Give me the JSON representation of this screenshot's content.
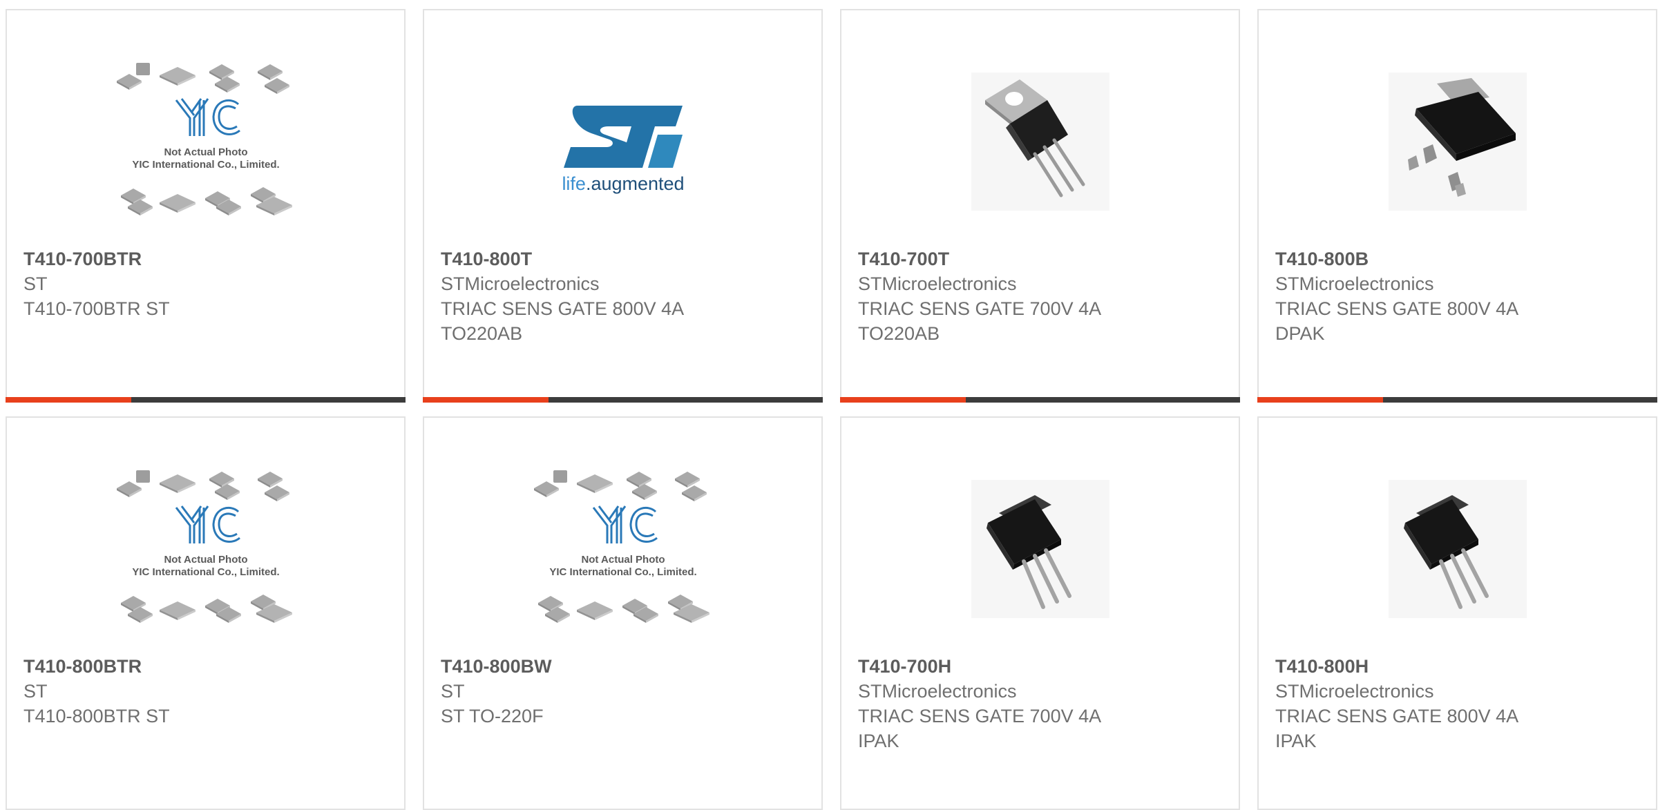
{
  "colors": {
    "accent": "#e8401c",
    "bar": "#3c3c3c",
    "border": "#e2e2e2",
    "text": "#6f6f6f",
    "st_blue": "#1f6fa3"
  },
  "placeholder": {
    "caption1": "Not Actual Photo",
    "caption2": "YIC International Co., Limited."
  },
  "st_logo": {
    "tagline_a": "life",
    "tagline_b": ".augmented"
  },
  "products": [
    {
      "part": "T410-700BTR",
      "maker": "ST",
      "desc1": "T410-700BTR ST",
      "desc2": "",
      "image": "yic-placeholder-icon"
    },
    {
      "part": "T410-800T",
      "maker": "STMicroelectronics",
      "desc1": "TRIAC SENS GATE 800V 4A",
      "desc2": "TO220AB",
      "image": "st-logo-icon"
    },
    {
      "part": "T410-700T",
      "maker": "STMicroelectronics",
      "desc1": "TRIAC SENS GATE 700V 4A",
      "desc2": "TO220AB",
      "image": "to220-package-icon"
    },
    {
      "part": "T410-800B",
      "maker": "STMicroelectronics",
      "desc1": "TRIAC SENS GATE 800V 4A",
      "desc2": "DPAK",
      "image": "dpak-package-icon"
    },
    {
      "part": "T410-800BTR",
      "maker": "ST",
      "desc1": "T410-800BTR ST",
      "desc2": "",
      "image": "yic-placeholder-icon"
    },
    {
      "part": "T410-800BW",
      "maker": "ST",
      "desc1": "ST TO-220F",
      "desc2": "",
      "image": "yic-placeholder-icon"
    },
    {
      "part": "T410-700H",
      "maker": "STMicroelectronics",
      "desc1": "TRIAC SENS GATE 700V 4A",
      "desc2": "IPAK",
      "image": "ipak-package-icon"
    },
    {
      "part": "T410-800H",
      "maker": "STMicroelectronics",
      "desc1": "TRIAC SENS GATE 800V 4A",
      "desc2": "IPAK",
      "image": "ipak-package-icon"
    }
  ]
}
